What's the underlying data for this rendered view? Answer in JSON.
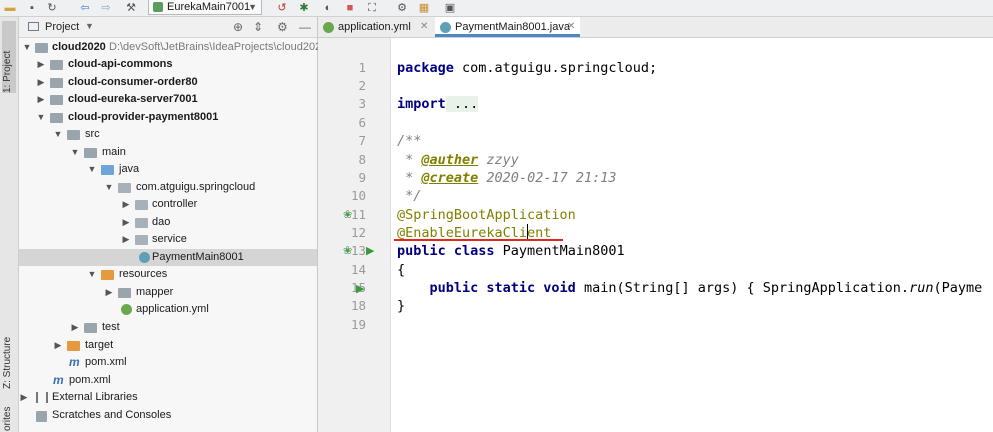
{
  "toolbar": {
    "run_config": "EurekaMain7001"
  },
  "side_tabs": {
    "project": "1: Project",
    "structure": "Z: Structure",
    "favorites": "orites"
  },
  "project_panel": {
    "title": "Project",
    "tree": [
      {
        "label": "cloud2020",
        "extra": "D:\\devSoft\\JetBrains\\IdeaProjects\\cloud202"
      },
      {
        "label": "cloud-api-commons"
      },
      {
        "label": "cloud-consumer-order80"
      },
      {
        "label": "cloud-eureka-server7001"
      },
      {
        "label": "cloud-provider-payment8001"
      },
      {
        "label": "src"
      },
      {
        "label": "main"
      },
      {
        "label": "java"
      },
      {
        "label": "com.atguigu.springcloud"
      },
      {
        "label": "controller"
      },
      {
        "label": "dao"
      },
      {
        "label": "service"
      },
      {
        "label": "PaymentMain8001"
      },
      {
        "label": "resources"
      },
      {
        "label": "mapper"
      },
      {
        "label": "application.yml"
      },
      {
        "label": "test"
      },
      {
        "label": "target"
      },
      {
        "label": "pom.xml"
      },
      {
        "label": "pom.xml"
      },
      {
        "label": "External Libraries"
      },
      {
        "label": "Scratches and Consoles"
      }
    ]
  },
  "editor": {
    "tabs": [
      {
        "label": "application.yml",
        "active": false
      },
      {
        "label": "PaymentMain8001.java",
        "active": true
      }
    ],
    "line_numbers": [
      "1",
      "2",
      "3",
      "6",
      "7",
      "8",
      "9",
      "10",
      "11",
      "12",
      "13",
      "14",
      "15",
      "18",
      "19"
    ],
    "code": {
      "l1_kw": "package",
      "l1_rest": " com.atguigu.springcloud;",
      "l3_kw": "import",
      "l3_rest": " ...",
      "l7": "/**",
      "l8_star": " * ",
      "l8_tag": "@auther",
      "l8_val": " zzyy",
      "l9_star": " * ",
      "l9_tag": "@create",
      "l9_val": " 2020-02-17 21:13",
      "l10": " */",
      "l11": "@SpringBootApplication",
      "l12": "@EnableEurekaClient",
      "l13_kw": "public class",
      "l13_rest": " PaymentMain8001",
      "l14": "{",
      "l15_kw": "    public static void",
      "l15_rest": " main(String[] args) { SpringApplication.",
      "l15_run": "run",
      "l15_tail": "(Payme",
      "l18": "}"
    }
  }
}
